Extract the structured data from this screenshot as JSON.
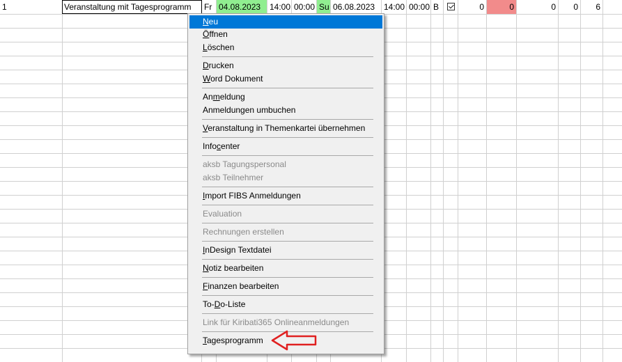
{
  "row": {
    "number": "1",
    "title": "Veranstaltung mit Tagesprogramm",
    "start_day": "Fr",
    "start_date": "04.08.2023",
    "start_time_1": "14:00",
    "start_time_2": "00:00",
    "end_day": "Su",
    "end_date": "06.08.2023",
    "end_time_1": "14:00",
    "end_time_2": "00:00",
    "code": "B",
    "checked": true,
    "num_1": "0",
    "num_2": "0",
    "num_3": "0",
    "num_4": "0",
    "num_5": "6"
  },
  "colors": {
    "green_cell": "#90ee90",
    "red_cell": "#f28b8b",
    "highlight": "#0078d7",
    "arrow": "#e02020"
  },
  "menu": {
    "items": [
      {
        "pre": "",
        "u": "N",
        "post": "eu"
      },
      {
        "pre": "",
        "u": "Ö",
        "post": "ffnen"
      },
      {
        "pre": "",
        "u": "L",
        "post": "öschen"
      },
      {
        "pre": "",
        "u": "D",
        "post": "rucken"
      },
      {
        "pre": "",
        "u": "W",
        "post": "ord Dokument"
      },
      {
        "pre": "An",
        "u": "m",
        "post": "eldung"
      },
      {
        "pre": "Anmeldungen umbuchen",
        "u": "",
        "post": ""
      },
      {
        "pre": "",
        "u": "V",
        "post": "eranstaltung in Themenkartei übernehmen"
      },
      {
        "pre": "Info",
        "u": "c",
        "post": "enter"
      },
      {
        "pre": "aksb Tagungspersonal",
        "u": "",
        "post": ""
      },
      {
        "pre": "aksb Teilnehmer",
        "u": "",
        "post": ""
      },
      {
        "pre": "",
        "u": "I",
        "post": "mport FIBS Anmeldungen"
      },
      {
        "pre": "Evaluation",
        "u": "",
        "post": ""
      },
      {
        "pre": "Rechnungen erstellen",
        "u": "",
        "post": ""
      },
      {
        "pre": "",
        "u": "I",
        "post": "nDesign Textdatei"
      },
      {
        "pre": "",
        "u": "N",
        "post": "otiz bearbeiten"
      },
      {
        "pre": "",
        "u": "F",
        "post": "inanzen bearbeiten"
      },
      {
        "pre": "To-",
        "u": "D",
        "post": "o-Liste"
      },
      {
        "pre": "Link für Kiribati365 Onlineanmeldungen",
        "u": "",
        "post": ""
      },
      {
        "pre": "",
        "u": "T",
        "post": "agesprogramm"
      }
    ]
  }
}
